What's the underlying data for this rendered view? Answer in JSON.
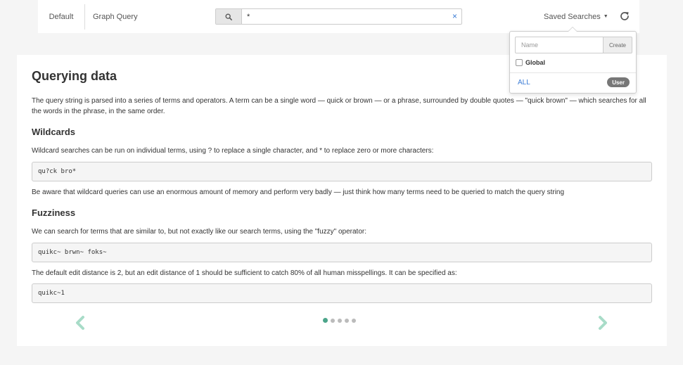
{
  "topbar": {
    "tab_default": "Default",
    "tab_graph": "Graph Query",
    "search_value": "*",
    "clear_symbol": "×",
    "saved_searches_label": "Saved Searches",
    "caret": "▼"
  },
  "saved_dropdown": {
    "name_placeholder": "Name",
    "create_label": "Create",
    "global_label": "Global",
    "all_label": "ALL",
    "user_badge": "User"
  },
  "content": {
    "title": "Querying data",
    "intro": "The query string is parsed into a series of terms and operators. A term can be a single word — quick or brown — or a phrase, surrounded by double quotes — \"quick brown\" — which searches for all the words in the phrase, in the same order.",
    "wildcards_heading": "Wildcards",
    "wildcards_text": "Wildcard searches can be run on individual terms, using ? to replace a single character, and * to replace zero or more characters:",
    "wildcards_code": "qu?ck bro*",
    "wildcards_note": "Be aware that wildcard queries can use an enormous amount of memory and perform very badly — just think how many terms need to be queried to match the query string",
    "fuzziness_heading": "Fuzziness",
    "fuzziness_text": "We can search for terms that are similar to, but not exactly like our search terms, using the \"fuzzy\" operator:",
    "fuzziness_code": "quikc~ brwn~ foks~",
    "fuzziness_note": "The default edit distance is 2, but an edit distance of 1 should be sufficient to catch 80% of all human misspellings. It can be specified as:",
    "fuzziness_code2": "quikc~1"
  },
  "carousel": {
    "page_count": 5,
    "active_page": 1,
    "accent_color": "#4ca58a",
    "arrow_color": "#a8dcc8"
  },
  "icons": {
    "search": "search-icon",
    "refresh": "refresh-icon",
    "prev": "chevron-left-icon",
    "next": "chevron-right-icon"
  }
}
